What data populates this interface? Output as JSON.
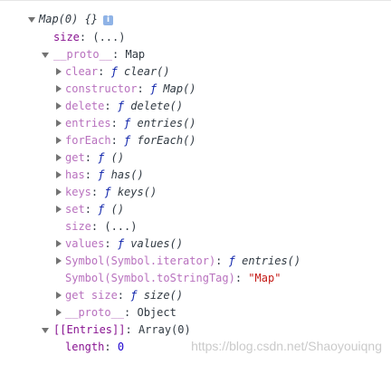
{
  "root": {
    "label": "Map(0) {}",
    "info_icon": "i"
  },
  "size_row": {
    "key": "size",
    "sep": ": ",
    "value": "(...)"
  },
  "proto": {
    "key": "__proto__",
    "sep": ": ",
    "value": "Map"
  },
  "clear": {
    "key": "clear",
    "sep": ": ",
    "f": "ƒ",
    "name": "clear()"
  },
  "constructor": {
    "key": "constructor",
    "sep": ": ",
    "f": "ƒ",
    "name": "Map()"
  },
  "delete": {
    "key": "delete",
    "sep": ": ",
    "f": "ƒ",
    "name": "delete()"
  },
  "entries": {
    "key": "entries",
    "sep": ": ",
    "f": "ƒ",
    "name": "entries()"
  },
  "foreach": {
    "key": "forEach",
    "sep": ": ",
    "f": "ƒ",
    "name": "forEach()"
  },
  "get": {
    "key": "get",
    "sep": ": ",
    "f": "ƒ",
    "name": "()"
  },
  "has": {
    "key": "has",
    "sep": ": ",
    "f": "ƒ",
    "name": "has()"
  },
  "keys": {
    "key": "keys",
    "sep": ": ",
    "f": "ƒ",
    "name": "keys()"
  },
  "set": {
    "key": "set",
    "sep": ": ",
    "f": "ƒ",
    "name": "()"
  },
  "size_inner": {
    "key": "size",
    "sep": ": ",
    "value": "(...)"
  },
  "values": {
    "key": "values",
    "sep": ": ",
    "f": "ƒ",
    "name": "values()"
  },
  "symbol_iterator": {
    "key": "Symbol(Symbol.iterator)",
    "sep": ": ",
    "f": "ƒ",
    "name": "entries()"
  },
  "symbol_tostringtag": {
    "key": "Symbol(Symbol.toStringTag)",
    "sep": ": ",
    "value": "\"Map\""
  },
  "get_size": {
    "key": "get size",
    "sep": ": ",
    "f": "ƒ",
    "name": "size()"
  },
  "proto_inner": {
    "key": "__proto__",
    "sep": ": ",
    "value": "Object"
  },
  "entries_internal": {
    "key": "[[Entries]]",
    "sep": ": ",
    "value": "Array(0)"
  },
  "length": {
    "key": "length",
    "sep": ": ",
    "value": "0"
  },
  "watermark": "https://blog.csdn.net/Shaoyouiqng",
  "colors": {
    "key": "#881391",
    "key_dim": "#b871be",
    "function_keyword": "#0d22aa",
    "string": "#c41a16",
    "number": "#1c00cf"
  }
}
